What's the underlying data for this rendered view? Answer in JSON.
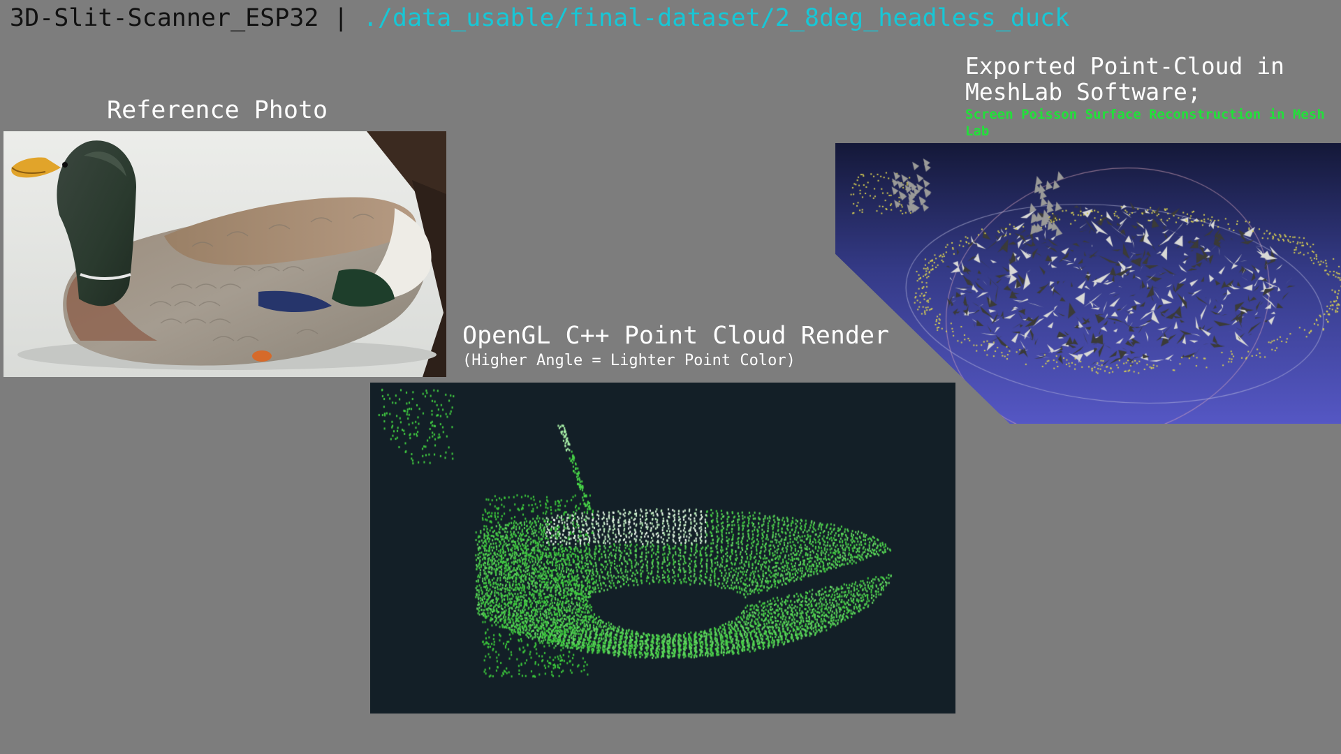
{
  "header": {
    "project": "3D-Slit-Scanner_ESP32",
    "separator": "|",
    "path": "./data_usable/final-dataset/2_8deg_headless_duck"
  },
  "reference": {
    "title": "Reference Photo"
  },
  "opengl": {
    "title": "OpenGL C++ Point Cloud Render",
    "subtitle": "(Higher Angle = Lighter Point Color)"
  },
  "meshlab": {
    "title_line1": "Exported Point-Cloud in",
    "title_line2": "MeshLab Software;",
    "subtitle": "Screen Poisson Surface Reconstruction in Mesh Lab"
  },
  "colors": {
    "background": "#7d7d7d",
    "path_accent": "#17c7d6",
    "meshlab_subtitle": "#22e03a",
    "opengl_background": "#131f27",
    "point_green": "#3fd13f"
  }
}
